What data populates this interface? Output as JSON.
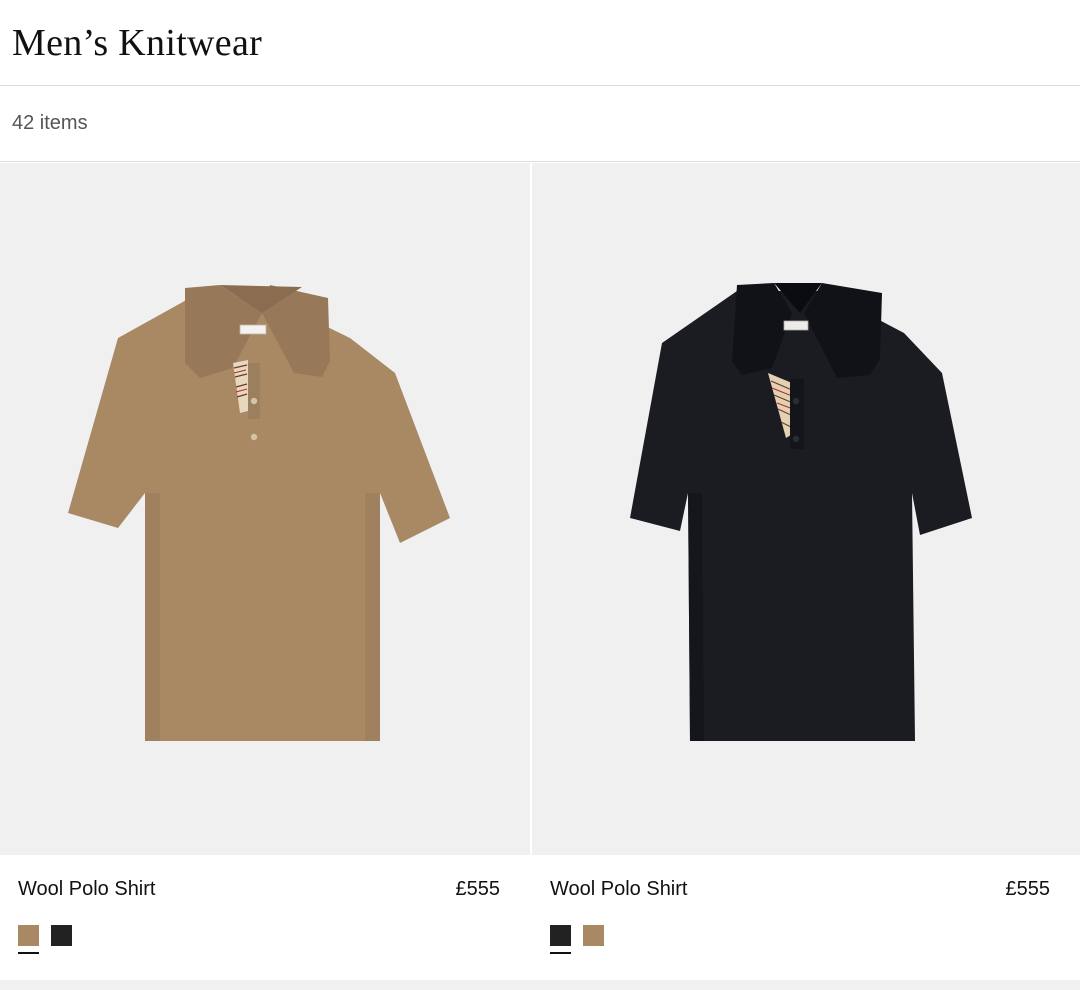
{
  "page": {
    "title": "Men’s Knitwear",
    "item_count": "42 items"
  },
  "products": [
    {
      "name": "Wool Polo Shirt",
      "price": "£555",
      "shirt_color": "#a88964",
      "shirt_shade": "#97795a",
      "swatches": [
        {
          "color": "#a88964",
          "selected": true,
          "name": "camel"
        },
        {
          "color": "#222222",
          "selected": false,
          "name": "black"
        }
      ]
    },
    {
      "name": "Wool Polo Shirt",
      "price": "£555",
      "shirt_color": "#1b1c22",
      "shirt_shade": "#111217",
      "swatches": [
        {
          "color": "#222222",
          "selected": true,
          "name": "black"
        },
        {
          "color": "#a88964",
          "selected": false,
          "name": "camel"
        }
      ]
    }
  ],
  "colors": {
    "image_bg": "#f0f0f0",
    "divider": "#dcdcdc"
  }
}
